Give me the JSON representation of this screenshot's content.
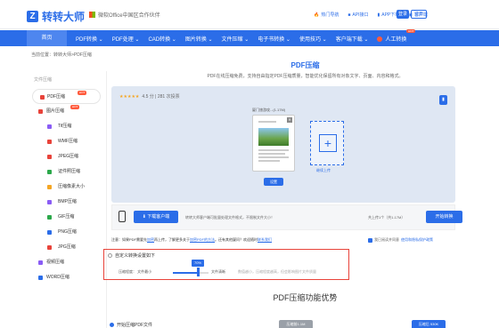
{
  "header": {
    "logo": "转转大师",
    "partner": "微软Office中国区合作伙伴",
    "links": [
      "热门导航",
      "API接口",
      "APP下载",
      "客户端"
    ],
    "login": "登录",
    "register": "注册"
  },
  "nav": {
    "home": "首页",
    "items": [
      "PDF转换",
      "PDF处理",
      "CAD转换",
      "图片转换",
      "文件压缩",
      "电子书转换",
      "使用技巧",
      "客户端下载",
      "人工转换"
    ],
    "hot_badge": "HOT"
  },
  "breadcrumb": "当前位置：转转大师>PDF压缩",
  "sidebar": {
    "category": "文件压缩",
    "items": [
      {
        "label": "PDF压缩",
        "badge": "HOT",
        "icon": "pdf-icon",
        "color": "#e8433a"
      },
      {
        "label": "图片压缩",
        "badge": "HOT",
        "icon": "image-icon",
        "color": "#e8433a"
      },
      {
        "label": "Tif压缩",
        "icon": "tif-icon",
        "color": "#8a5cf5"
      },
      {
        "label": "WMF压缩",
        "icon": "wmf-icon",
        "color": "#e8433a"
      },
      {
        "label": "JPEG压缩",
        "icon": "jpeg-icon",
        "color": "#e8433a"
      },
      {
        "label": "证件照压缩",
        "icon": "id-photo-icon",
        "color": "#2ba84a"
      },
      {
        "label": "压缩像素大小",
        "icon": "pixel-icon",
        "color": "#f5a623"
      },
      {
        "label": "BMP压缩",
        "icon": "bmp-icon",
        "color": "#8a5cf5"
      },
      {
        "label": "GIF压缩",
        "icon": "gif-icon",
        "color": "#2ba84a"
      },
      {
        "label": "PNG压缩",
        "icon": "png-icon",
        "color": "#2b6de8"
      },
      {
        "label": "JPG压缩",
        "icon": "jpg-icon",
        "color": "#e8433a"
      },
      {
        "label": "视频压缩",
        "icon": "video-icon",
        "color": "#8a5cf5"
      },
      {
        "label": "WORD压缩",
        "icon": "word-icon",
        "color": "#2b6de8"
      }
    ]
  },
  "main": {
    "title": "PDF压缩",
    "subtitle": "PDF在线压缩免费，支持自由指定PDF压缩质量，智能优化保留所有对象文字、页面、内容和格式。",
    "stars": "★★★★★",
    "rating": "4.5 分 | 281 次投票",
    "file_label": "厦门旅游攻...(1.17M)",
    "settings_btn": "设置",
    "add_label": "继续上传",
    "download_btn": "下载客户端",
    "download_text": "转转大师客户端可批量处理文件格式，不限制文件大小！",
    "count_text": "共上传1个（共1.17M）",
    "start_btn": "开始转换",
    "notice_prefix": "注意：如果PDF需要先",
    "notice_link1": "加密",
    "notice_middle": "再上传，了解更多关于",
    "notice_link2": "加密PDF的方法",
    "notice_suffix": "。还有其他疑问？欢迎随时",
    "notice_link3": "联系我们",
    "agree_prefix": "我已阅读并同意",
    "agree_link": "使用和隐私保护政策",
    "custom_title": "自定义转换设置如下",
    "compress_label": "压缩程度：",
    "small_label": "文件最小",
    "large_label": "文件清晰",
    "slider_value": "70%",
    "slider_fraction": 0.7,
    "hint": "数值越小，压缩程度越高，但会影响图片文件质量",
    "adv_title": "PDF压缩功能优势",
    "bottom_left": "开始压缩PDF文件",
    "bottom_tab1": "压缩前1.1M",
    "bottom_tab2": "压缩后 530K"
  },
  "colors": {
    "accent": "#2b6de8",
    "highlight": "#e8433a",
    "hot": "#ff5a3c"
  }
}
